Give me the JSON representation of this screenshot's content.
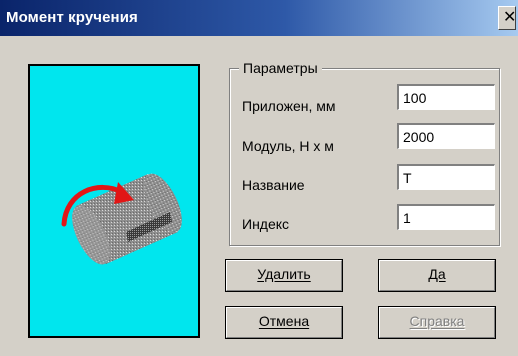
{
  "window": {
    "title": "Момент кручения",
    "close_glyph": "✕"
  },
  "group": {
    "legend": "Параметры"
  },
  "fields": [
    {
      "label": "Приложен, мм",
      "value": "100"
    },
    {
      "label": "Модуль, Н х м",
      "value": "2000"
    },
    {
      "label": "Название",
      "value": "T"
    },
    {
      "label": "Индекс",
      "value": "1"
    }
  ],
  "buttons": {
    "delete": "Удалить",
    "ok": "Да",
    "cancel": "Отмена",
    "help": "Справка"
  },
  "preview": {
    "background": "#00e6ee",
    "shaft_color": "#999999",
    "arrow_color": "#e21616",
    "icon": "torque-shaft-icon"
  }
}
